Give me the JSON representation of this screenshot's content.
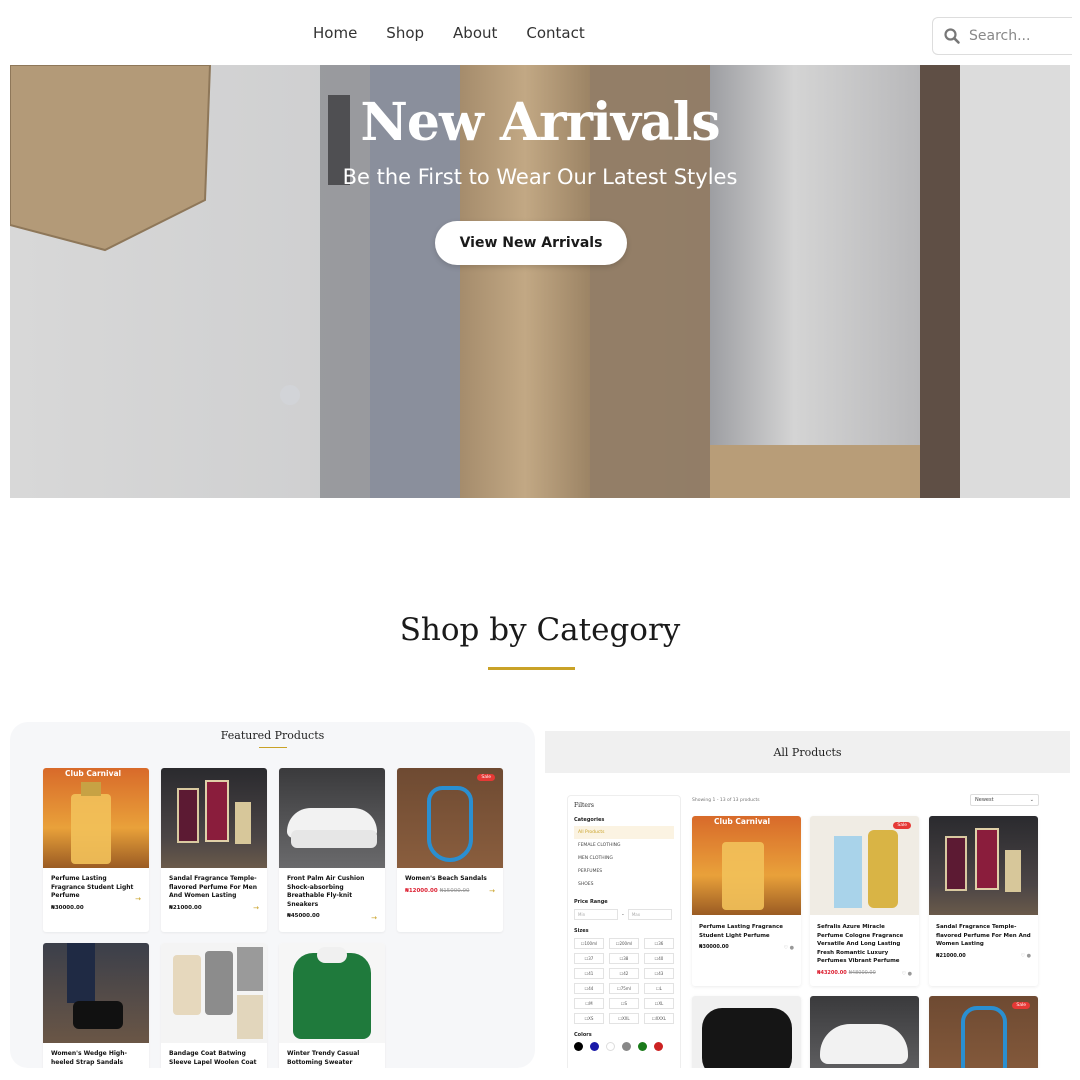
{
  "nav": {
    "links": [
      "Home",
      "Shop",
      "About",
      "Contact"
    ],
    "search_placeholder": "Search..."
  },
  "hero": {
    "title": "New Arrivals",
    "subtitle": "Be the First to Wear Our Latest Styles",
    "button": "View New Arrivals"
  },
  "section": {
    "title": "Shop by Category"
  },
  "featured": {
    "title": "Featured Products",
    "products": [
      {
        "name": "Perfume Lasting Fragrance Student Light Perfume",
        "price": "₦30000.00",
        "old_price": "",
        "img_label": "Club Carnival",
        "sale": false
      },
      {
        "name": "Sandal Fragrance Temple-flavored Perfume For Men And Women Lasting",
        "price": "₦21000.00",
        "old_price": "",
        "img_label": "",
        "sale": false
      },
      {
        "name": "Front Palm Air Cushion Shock-absorbing Breathable Fly-knit Sneakers",
        "price": "₦45000.00",
        "old_price": "",
        "img_label": "",
        "sale": false
      },
      {
        "name": "Women's Beach Sandals",
        "price": "₦12000.00",
        "old_price": "₦15000.00",
        "img_label": "",
        "sale": true
      },
      {
        "name": "Women's Wedge High-heeled Strap Sandals",
        "price": "",
        "old_price": "",
        "img_label": "",
        "sale": false
      },
      {
        "name": "Bandage Coat Batwing Sleeve Lapel Woolen Coat",
        "price": "",
        "old_price": "",
        "img_label": "",
        "sale": false
      },
      {
        "name": "Winter Trendy Casual Bottoming Sweater",
        "price": "",
        "old_price": "",
        "img_label": "",
        "sale": false
      }
    ],
    "sale_badge": "Sale"
  },
  "all_products": {
    "title": "All Products",
    "showing": "Showing 1 - 13 of 13 products",
    "sort": "Newest",
    "filters": {
      "title": "Filters",
      "categories_label": "Categories",
      "categories": [
        "All Products",
        "FEMALE CLOTHING",
        "MEN CLOTHING",
        "PERFUMES",
        "SHOES"
      ],
      "price_label": "Price Range",
      "min": "Min",
      "max": "Max",
      "range_sep": "-",
      "sizes_label": "Sizes",
      "sizes": [
        "100ml",
        "200ml",
        "36",
        "37",
        "38",
        "40",
        "41",
        "42",
        "43",
        "44",
        "75ml",
        "L",
        "M",
        "S",
        "XL",
        "XS",
        "XXL",
        "XXXL"
      ],
      "colors_label": "Colors",
      "colors": [
        "#000000",
        "#1a1aa8",
        "#ffffff",
        "#888888",
        "#1a7a1a",
        "#cc2222"
      ]
    },
    "products": [
      {
        "name": "Perfume Lasting Fragrance Student Light Perfume",
        "price": "₦30000.00",
        "old_price": "",
        "img_label": "Club Carnival",
        "sale": false
      },
      {
        "name": "Sefralis Azure Miracle Perfume Cologne Fragrance Versatile And Long Lasting Fresh Romantic Luxury Perfumes Vibrant Perfume",
        "price": "₦43200.00",
        "old_price": "₦48000.00",
        "img_label": "",
        "sale": true
      },
      {
        "name": "Sandal Fragrance Temple-flavored Perfume For Men And Women Lasting",
        "price": "₦21000.00",
        "old_price": "",
        "img_label": "",
        "sale": false
      }
    ]
  },
  "colors": {
    "accent": "#c9a227",
    "sale": "#e53935"
  }
}
